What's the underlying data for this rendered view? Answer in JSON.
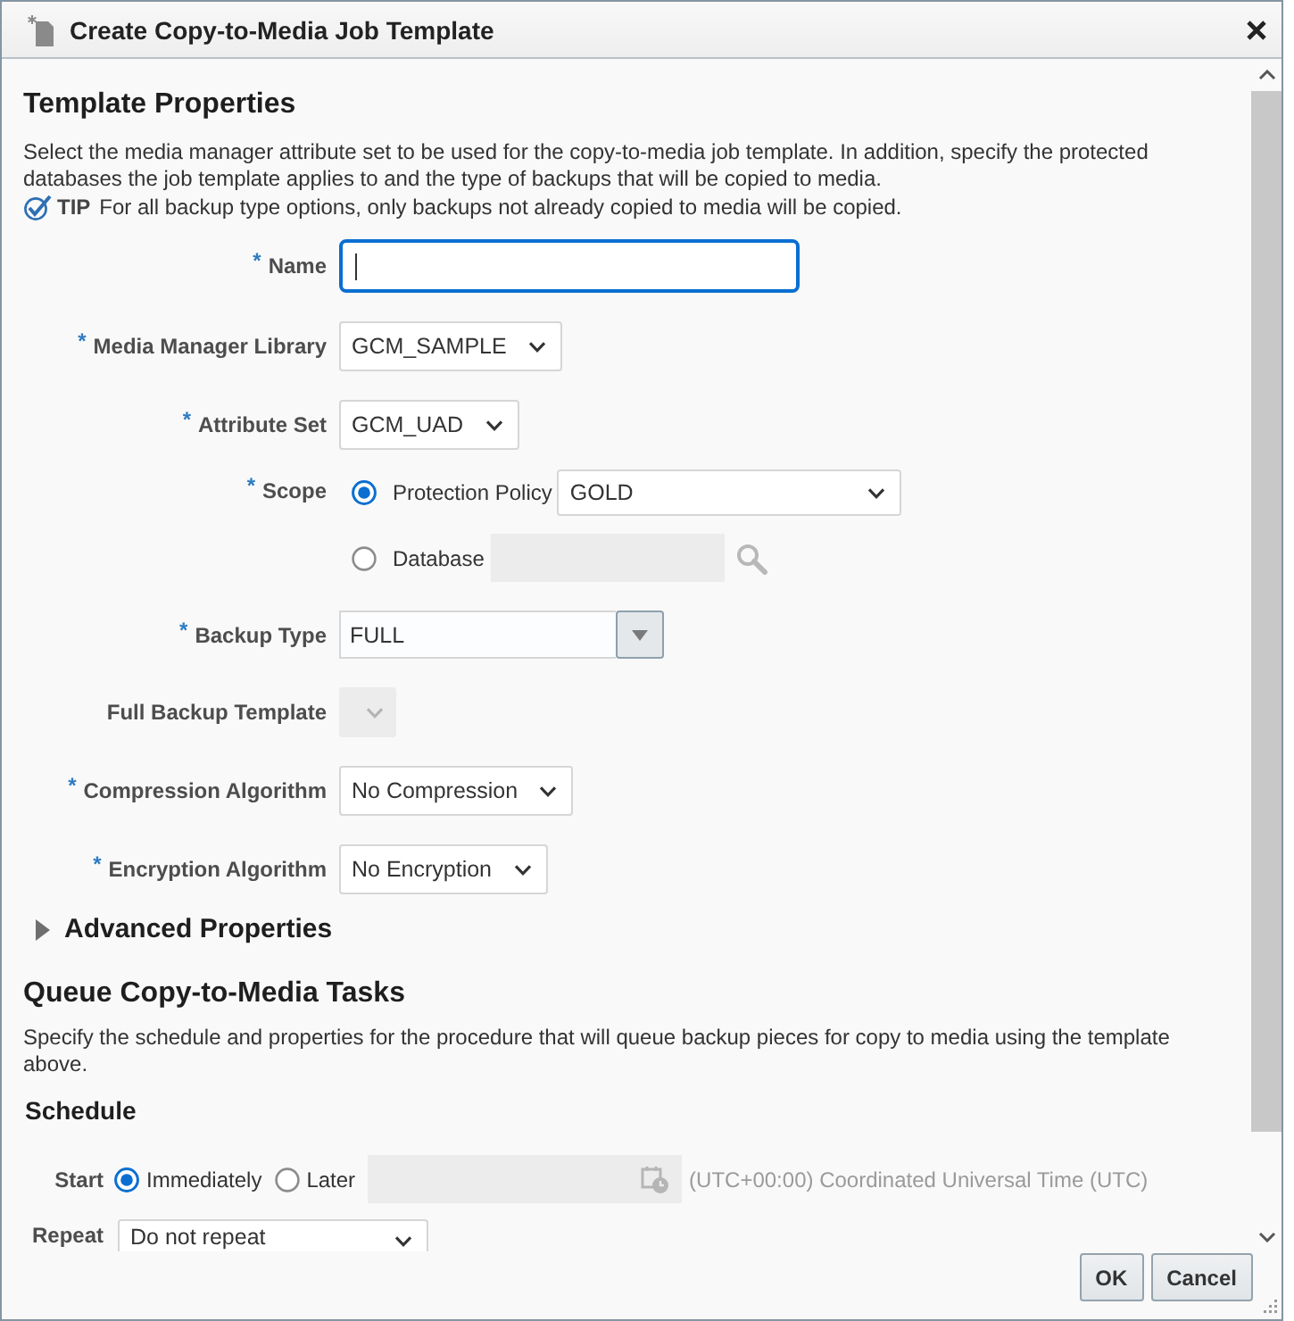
{
  "window": {
    "title": "Create Copy-to-Media Job Template"
  },
  "template_properties": {
    "heading": "Template Properties",
    "description": "Select the media manager attribute set to be used for the copy-to-media job template. In addition, specify the protected databases the job template applies to and the type of backups that will be copied to media.",
    "tip": {
      "label": "TIP",
      "text": "For all backup type options, only backups not already copied to media will be copied."
    },
    "fields": [
      {
        "kind": "text",
        "required_mark": "*",
        "label": "Name",
        "focused": true,
        "disabled": false
      },
      {
        "kind": "select",
        "required_mark": "*",
        "label": "Media Manager Library",
        "value": "GCM_SAMPLE",
        "disabled": false
      },
      {
        "kind": "select",
        "required_mark": "*",
        "label": "Attribute Set",
        "value": "GCM_UAD",
        "disabled": false
      },
      {
        "kind": "radio_group",
        "required_mark": "*",
        "label": "Scope",
        "options": [
          {
            "label": "Protection Policy",
            "selected": true,
            "field": {
              "kind": "select",
              "value": "GOLD",
              "disabled": false
            }
          },
          {
            "label": "Database",
            "selected": false,
            "field": {
              "kind": "lookup",
              "disabled": true
            }
          }
        ]
      },
      {
        "kind": "combo",
        "required_mark": "*",
        "label": "Backup Type",
        "value": "FULL",
        "disabled": false
      },
      {
        "kind": "select",
        "label": "Full Backup Template",
        "disabled": true
      },
      {
        "kind": "select",
        "required_mark": "*",
        "label": "Compression Algorithm",
        "value": "No Compression",
        "disabled": false
      },
      {
        "kind": "select",
        "required_mark": "*",
        "label": "Encryption Algorithm",
        "value": "No Encryption",
        "disabled": false
      }
    ],
    "advanced_properties": {
      "label": "Advanced Properties",
      "expanded": false
    }
  },
  "queue_tasks": {
    "heading": "Queue Copy-to-Media Tasks",
    "description": "Specify the schedule and properties for the procedure that will queue backup pieces for copy to media using the template above.",
    "schedule": {
      "heading": "Schedule",
      "start": {
        "label": "Start",
        "options": [
          {
            "label": "Immediately",
            "selected": true
          },
          {
            "label": "Later",
            "selected": false
          }
        ],
        "datetime_field": {
          "disabled": true
        },
        "timezone": "(UTC+00:00) Coordinated Universal Time (UTC)"
      },
      "repeat": {
        "label": "Repeat",
        "value": "Do not repeat"
      }
    }
  },
  "buttons": [
    {
      "label": "OK"
    },
    {
      "label": "Cancel"
    }
  ]
}
